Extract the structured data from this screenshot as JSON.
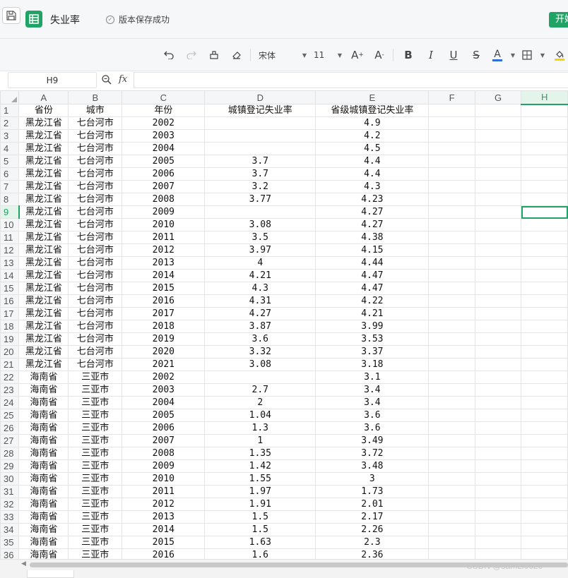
{
  "app": {
    "doc_title": "失业率",
    "save_status": "版本保存成功",
    "start_button": "开始"
  },
  "toolbar": {
    "font_name": "宋体",
    "font_size": "11",
    "bold": "B",
    "italic": "I",
    "underline": "U",
    "strike": "S",
    "font_color_label": "A",
    "font_color": "#2f6fd6",
    "fill_color": "#f5d400"
  },
  "formula_bar": {
    "cell_ref": "H9",
    "fx": "fx",
    "value": ""
  },
  "sheet": {
    "columns": [
      "A",
      "B",
      "C",
      "D",
      "E",
      "F",
      "G",
      "H"
    ],
    "selected_cell": "H9",
    "rows": [
      {
        "n": "1",
        "a": "省份",
        "b": "城市",
        "c": "年份",
        "d": "城镇登记失业率",
        "e": "省级城镇登记失业率"
      },
      {
        "n": "2",
        "a": "黑龙江省",
        "b": "七台河市",
        "c": "2002",
        "d": "",
        "e": "4.9"
      },
      {
        "n": "3",
        "a": "黑龙江省",
        "b": "七台河市",
        "c": "2003",
        "d": "",
        "e": "4.2"
      },
      {
        "n": "4",
        "a": "黑龙江省",
        "b": "七台河市",
        "c": "2004",
        "d": "",
        "e": "4.5"
      },
      {
        "n": "5",
        "a": "黑龙江省",
        "b": "七台河市",
        "c": "2005",
        "d": "3.7",
        "e": "4.4"
      },
      {
        "n": "6",
        "a": "黑龙江省",
        "b": "七台河市",
        "c": "2006",
        "d": "3.7",
        "e": "4.4"
      },
      {
        "n": "7",
        "a": "黑龙江省",
        "b": "七台河市",
        "c": "2007",
        "d": "3.2",
        "e": "4.3"
      },
      {
        "n": "8",
        "a": "黑龙江省",
        "b": "七台河市",
        "c": "2008",
        "d": "3.77",
        "e": "4.23"
      },
      {
        "n": "9",
        "a": "黑龙江省",
        "b": "七台河市",
        "c": "2009",
        "d": "",
        "e": "4.27"
      },
      {
        "n": "10",
        "a": "黑龙江省",
        "b": "七台河市",
        "c": "2010",
        "d": "3.08",
        "e": "4.27"
      },
      {
        "n": "11",
        "a": "黑龙江省",
        "b": "七台河市",
        "c": "2011",
        "d": "3.5",
        "e": "4.38"
      },
      {
        "n": "12",
        "a": "黑龙江省",
        "b": "七台河市",
        "c": "2012",
        "d": "3.97",
        "e": "4.15"
      },
      {
        "n": "13",
        "a": "黑龙江省",
        "b": "七台河市",
        "c": "2013",
        "d": "4",
        "e": "4.44"
      },
      {
        "n": "14",
        "a": "黑龙江省",
        "b": "七台河市",
        "c": "2014",
        "d": "4.21",
        "e": "4.47"
      },
      {
        "n": "15",
        "a": "黑龙江省",
        "b": "七台河市",
        "c": "2015",
        "d": "4.3",
        "e": "4.47"
      },
      {
        "n": "16",
        "a": "黑龙江省",
        "b": "七台河市",
        "c": "2016",
        "d": "4.31",
        "e": "4.22"
      },
      {
        "n": "17",
        "a": "黑龙江省",
        "b": "七台河市",
        "c": "2017",
        "d": "4.27",
        "e": "4.21"
      },
      {
        "n": "18",
        "a": "黑龙江省",
        "b": "七台河市",
        "c": "2018",
        "d": "3.87",
        "e": "3.99"
      },
      {
        "n": "19",
        "a": "黑龙江省",
        "b": "七台河市",
        "c": "2019",
        "d": "3.6",
        "e": "3.53"
      },
      {
        "n": "20",
        "a": "黑龙江省",
        "b": "七台河市",
        "c": "2020",
        "d": "3.32",
        "e": "3.37"
      },
      {
        "n": "21",
        "a": "黑龙江省",
        "b": "七台河市",
        "c": "2021",
        "d": "3.08",
        "e": "3.18"
      },
      {
        "n": "22",
        "a": "海南省",
        "b": "三亚市",
        "c": "2002",
        "d": "",
        "e": "3.1"
      },
      {
        "n": "23",
        "a": "海南省",
        "b": "三亚市",
        "c": "2003",
        "d": "2.7",
        "e": "3.4"
      },
      {
        "n": "24",
        "a": "海南省",
        "b": "三亚市",
        "c": "2004",
        "d": "2",
        "e": "3.4"
      },
      {
        "n": "25",
        "a": "海南省",
        "b": "三亚市",
        "c": "2005",
        "d": "1.04",
        "e": "3.6"
      },
      {
        "n": "26",
        "a": "海南省",
        "b": "三亚市",
        "c": "2006",
        "d": "1.3",
        "e": "3.6"
      },
      {
        "n": "27",
        "a": "海南省",
        "b": "三亚市",
        "c": "2007",
        "d": "1",
        "e": "3.49"
      },
      {
        "n": "28",
        "a": "海南省",
        "b": "三亚市",
        "c": "2008",
        "d": "1.35",
        "e": "3.72"
      },
      {
        "n": "29",
        "a": "海南省",
        "b": "三亚市",
        "c": "2009",
        "d": "1.42",
        "e": "3.48"
      },
      {
        "n": "30",
        "a": "海南省",
        "b": "三亚市",
        "c": "2010",
        "d": "1.55",
        "e": "3"
      },
      {
        "n": "31",
        "a": "海南省",
        "b": "三亚市",
        "c": "2011",
        "d": "1.97",
        "e": "1.73"
      },
      {
        "n": "32",
        "a": "海南省",
        "b": "三亚市",
        "c": "2012",
        "d": "1.91",
        "e": "2.01"
      },
      {
        "n": "33",
        "a": "海南省",
        "b": "三亚市",
        "c": "2013",
        "d": "1.5",
        "e": "2.17"
      },
      {
        "n": "34",
        "a": "海南省",
        "b": "三亚市",
        "c": "2014",
        "d": "1.5",
        "e": "2.26"
      },
      {
        "n": "35",
        "a": "海南省",
        "b": "三亚市",
        "c": "2015",
        "d": "1.63",
        "e": "2.3"
      },
      {
        "n": "36",
        "a": "海南省",
        "b": "三亚市",
        "c": "2016",
        "d": "1.6",
        "e": "2.36"
      }
    ]
  },
  "watermark": "CSDN @samLi0620"
}
